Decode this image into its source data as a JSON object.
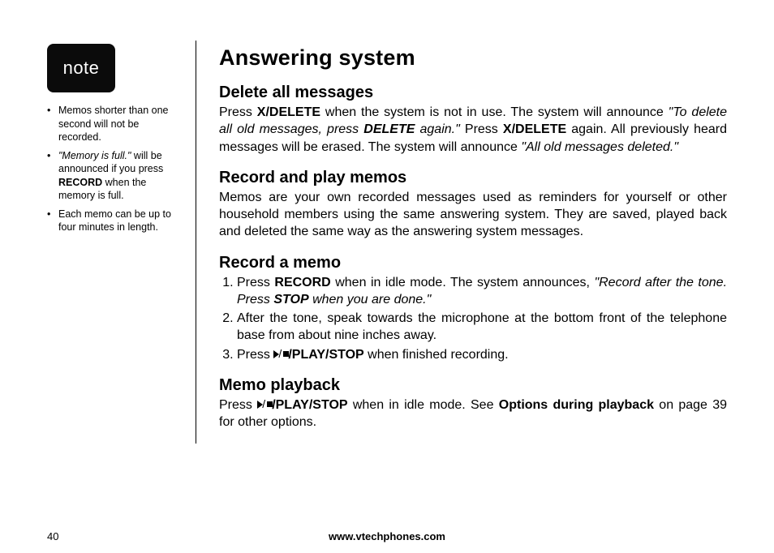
{
  "sidebar": {
    "note_badge": "note",
    "items": [
      {
        "text_html": "Memos shorter than one second will not be recorded."
      },
      {
        "text_html": "<span class=\"i\">\"Memory is full.\"</span> will be announced if you press <span class=\"b\">RECORD</span> when the memory is full."
      },
      {
        "text_html": "Each memo can be up to four minutes in length."
      }
    ]
  },
  "main": {
    "title": "Answering system",
    "sections": {
      "delete_all": {
        "heading": "Delete all messages",
        "body_html": "Press <span class=\"b\">X/DELETE</span> when the system is not in use. The system will announce <span class=\"i\">\"To delete all old messages, press <span class=\"bi\">DELETE</span> again.\"</span> Press <span class=\"b\">X/DELETE</span> again. All previously heard messages will be erased. The system will announce <span class=\"i\">\"All old messages deleted.\"</span>"
      },
      "record_play": {
        "heading": "Record and play memos",
        "body_html": "Memos are your own recorded messages used as reminders for yourself or other household members using the same answering system. They are saved, played back and deleted the same way as the answering system messages."
      },
      "record_memo": {
        "heading": "Record a memo",
        "steps": [
          "Press <span class=\"b\">RECORD</span> when in idle mode. The system announces, <span class=\"i\">\"Record after the tone. Press <span class=\"bi\">STOP</span> when you are done.\"</span>",
          "After the tone, speak towards the microphone at the bottom front of the telephone base from about nine inches away.",
          "Press <span class=\"play-icon\" data-name=\"play-stop-icon\" data-interactable=\"false\"><span class=\"tri\"></span><span class=\"slash\">/</span><span class=\"sq\"></span></span><span class=\"b\">/PLAY/STOP</span> when finished recording."
        ]
      },
      "memo_playback": {
        "heading": "Memo playback",
        "body_html": "Press <span class=\"play-icon\" data-name=\"play-stop-icon\" data-interactable=\"false\"><span class=\"tri\"></span><span class=\"slash\">/</span><span class=\"sq\"></span></span><span class=\"b\">/PLAY/STOP</span> when in idle mode. See <span class=\"b\">Options during playback</span> on page 39 for other options."
      }
    }
  },
  "footer": {
    "page_number": "40",
    "url": "www.vtechphones.com"
  }
}
